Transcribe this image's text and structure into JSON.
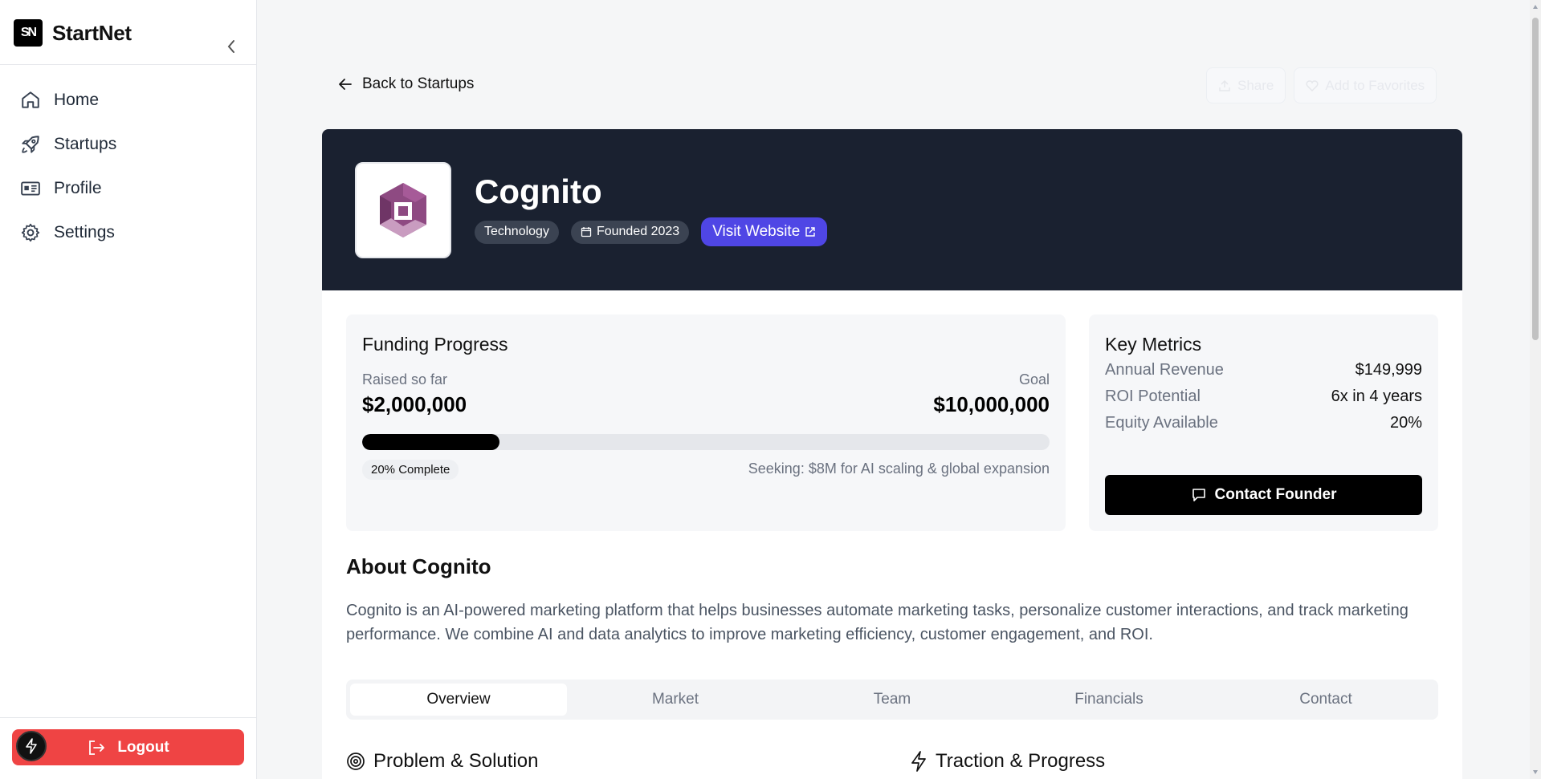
{
  "sidebar": {
    "brand_logo_text": "SN",
    "brand_name": "StartNet",
    "items": [
      {
        "label": "Home",
        "icon": "home-icon"
      },
      {
        "label": "Startups",
        "icon": "rocket-icon"
      },
      {
        "label": "Profile",
        "icon": "id-card-icon"
      },
      {
        "label": "Settings",
        "icon": "gear-icon"
      }
    ],
    "logout_label": "Logout"
  },
  "header": {
    "back_label": "Back to Startups",
    "share_label": "Share",
    "favorite_label": "Add to Favorites"
  },
  "startup": {
    "name": "Cognito",
    "category": "Technology",
    "founded": "Founded 2023",
    "visit_label": "Visit Website"
  },
  "funding": {
    "title": "Funding Progress",
    "raised_label": "Raised so far",
    "raised_value": "$2,000,000",
    "goal_label": "Goal",
    "goal_value": "$10,000,000",
    "progress_fraction": 0.2,
    "progress_label": "20% Complete",
    "seeking": "Seeking: $8M for AI scaling & global expansion"
  },
  "metrics": {
    "title": "Key Metrics",
    "rows": [
      {
        "key": "Annual Revenue",
        "value": "$149,999"
      },
      {
        "key": "ROI Potential",
        "value": "6x in 4 years"
      },
      {
        "key": "Equity Available",
        "value": "20%"
      }
    ],
    "contact_label": "Contact Founder"
  },
  "about": {
    "title": "About Cognito",
    "text": "Cognito is an AI-powered marketing platform that helps businesses automate marketing tasks, personalize customer interactions, and track marketing performance. We combine AI and data analytics to improve marketing efficiency, customer engagement, and ROI."
  },
  "tabs": [
    "Overview",
    "Market",
    "Team",
    "Financials",
    "Contact"
  ],
  "sections": {
    "problem": "Problem & Solution",
    "traction": "Traction & Progress"
  },
  "colors": {
    "hero_bg": "#1a2130",
    "accent": "#4f46e5",
    "logout": "#ef4444",
    "logo_purple": "#8e4a82"
  }
}
